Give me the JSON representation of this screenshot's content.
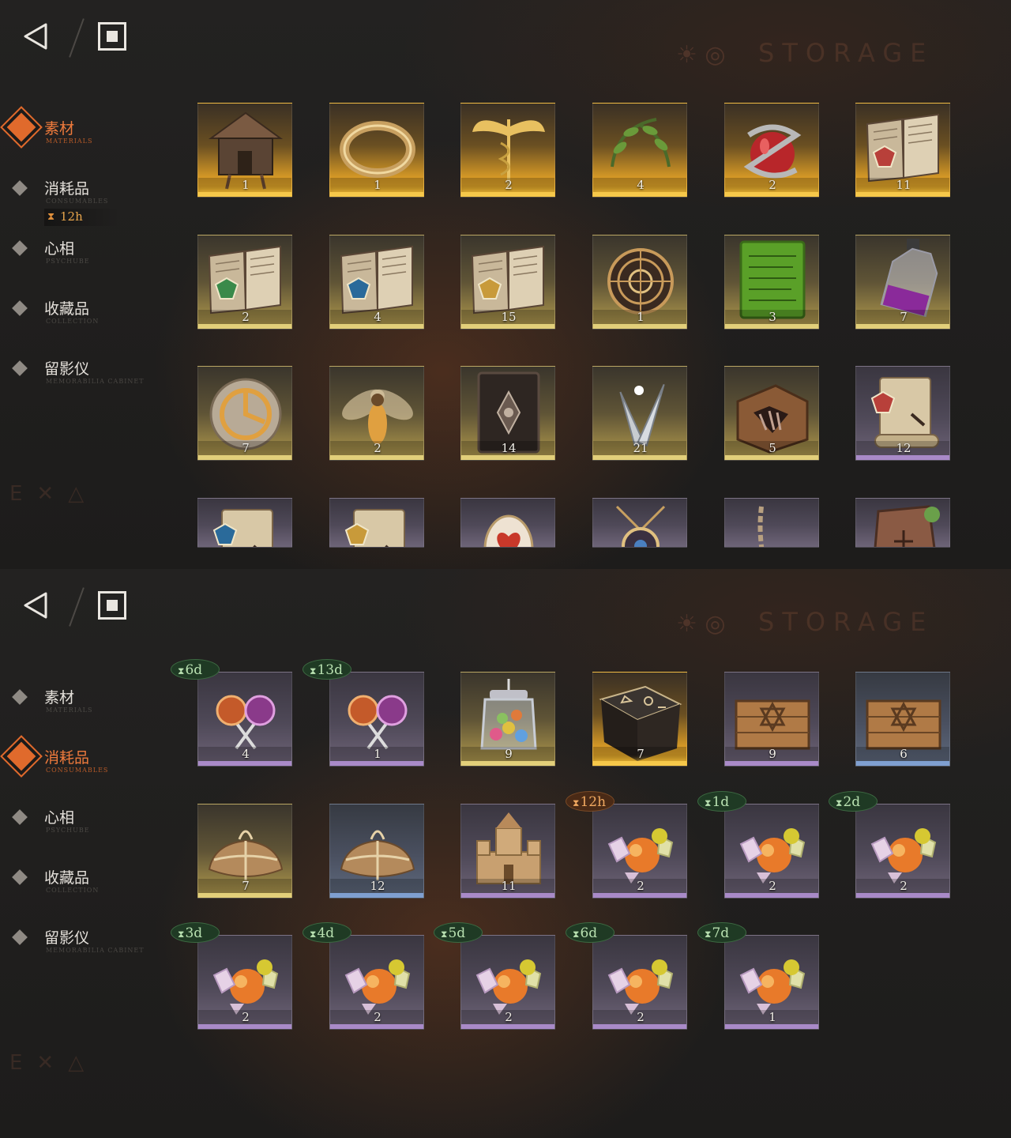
{
  "panels": [
    {
      "storage_title": "STORAGE",
      "nav": [
        {
          "label": "素材",
          "sub": "MATERIALS",
          "active": true
        },
        {
          "label": "消耗品",
          "sub": "CONSUMABLES",
          "active": false,
          "timer": "12h"
        },
        {
          "label": "心相",
          "sub": "PSYCHUBE",
          "active": false
        },
        {
          "label": "收藏品",
          "sub": "COLLECTION",
          "active": false
        },
        {
          "label": "留影仪",
          "sub": "MEMORABILIA CABINET",
          "active": false
        }
      ],
      "items": [
        {
          "icon": "hut-icon",
          "count": "1",
          "rarity": "gold"
        },
        {
          "icon": "ring-icon",
          "count": "1",
          "rarity": "gold"
        },
        {
          "icon": "caduceus-icon",
          "count": "2",
          "rarity": "gold"
        },
        {
          "icon": "laurel-wreath-icon",
          "count": "4",
          "rarity": "gold"
        },
        {
          "icon": "snake-apple-icon",
          "count": "2",
          "rarity": "gold"
        },
        {
          "icon": "red-rune-book-icon",
          "count": "11",
          "rarity": "gold"
        },
        {
          "icon": "green-rune-book-icon",
          "count": "2",
          "rarity": "yellow"
        },
        {
          "icon": "blue-rune-book-icon",
          "count": "4",
          "rarity": "yellow"
        },
        {
          "icon": "gold-rune-book-icon",
          "count": "15",
          "rarity": "yellow"
        },
        {
          "icon": "astrolabe-icon",
          "count": "1",
          "rarity": "yellow"
        },
        {
          "icon": "green-tablet-icon",
          "count": "3",
          "rarity": "yellow"
        },
        {
          "icon": "potion-bottle-icon",
          "count": "7",
          "rarity": "yellow"
        },
        {
          "icon": "clockwork-sphere-icon",
          "count": "7",
          "rarity": "yellow"
        },
        {
          "icon": "firefly-icon",
          "count": "2",
          "rarity": "yellow"
        },
        {
          "icon": "dark-tome-icon",
          "count": "14",
          "rarity": "yellow"
        },
        {
          "icon": "silver-bullets-icon",
          "count": "21",
          "rarity": "yellow"
        },
        {
          "icon": "claw-box-icon",
          "count": "5",
          "rarity": "yellow"
        },
        {
          "icon": "red-scroll-icon",
          "count": "12",
          "rarity": "purple"
        },
        {
          "icon": "blue-scroll-icon",
          "count": "",
          "rarity": "purple"
        },
        {
          "icon": "gold-scroll-icon",
          "count": "",
          "rarity": "purple"
        },
        {
          "icon": "ornate-egg-icon",
          "count": "",
          "rarity": "purple"
        },
        {
          "icon": "amulet-icon",
          "count": "",
          "rarity": "purple"
        },
        {
          "icon": "chain-icon",
          "count": "",
          "rarity": "purple"
        },
        {
          "icon": "stone-fragment-icon",
          "count": "",
          "rarity": "purple"
        }
      ]
    },
    {
      "storage_title": "STORAGE",
      "nav": [
        {
          "label": "素材",
          "sub": "MATERIALS",
          "active": false
        },
        {
          "label": "消耗品",
          "sub": "CONSUMABLES",
          "active": true
        },
        {
          "label": "心相",
          "sub": "PSYCHUBE",
          "active": false
        },
        {
          "label": "收藏品",
          "sub": "COLLECTION",
          "active": false
        },
        {
          "label": "留影仪",
          "sub": "MEMORABILIA CABINET",
          "active": false
        }
      ],
      "items": [
        {
          "icon": "lollipop-icon",
          "count": "4",
          "rarity": "purple",
          "timer": "6d",
          "timer_color": "green"
        },
        {
          "icon": "lollipop-icon",
          "count": "1",
          "rarity": "purple",
          "timer": "13d",
          "timer_color": "green"
        },
        {
          "icon": "candy-jar-icon",
          "count": "9",
          "rarity": "yellow"
        },
        {
          "icon": "rune-cube-icon",
          "count": "7",
          "rarity": "gold"
        },
        {
          "icon": "wooden-crate-icon",
          "count": "9",
          "rarity": "purple"
        },
        {
          "icon": "wooden-crate-icon",
          "count": "6",
          "rarity": "blue"
        },
        {
          "icon": "parcel-icon",
          "count": "7",
          "rarity": "yellow"
        },
        {
          "icon": "parcel-icon",
          "count": "12",
          "rarity": "blue"
        },
        {
          "icon": "sand-castle-icon",
          "count": "11",
          "rarity": "purple"
        },
        {
          "icon": "candy-icon",
          "count": "2",
          "rarity": "purple",
          "timer": "12h",
          "timer_color": "orange"
        },
        {
          "icon": "candy-icon",
          "count": "2",
          "rarity": "purple",
          "timer": "1d",
          "timer_color": "green"
        },
        {
          "icon": "candy-icon",
          "count": "2",
          "rarity": "purple",
          "timer": "2d",
          "timer_color": "green"
        },
        {
          "icon": "candy-icon",
          "count": "2",
          "rarity": "purple",
          "timer": "3d",
          "timer_color": "green"
        },
        {
          "icon": "candy-icon",
          "count": "2",
          "rarity": "purple",
          "timer": "4d",
          "timer_color": "green"
        },
        {
          "icon": "candy-icon",
          "count": "2",
          "rarity": "purple",
          "timer": "5d",
          "timer_color": "green"
        },
        {
          "icon": "candy-icon",
          "count": "2",
          "rarity": "purple",
          "timer": "6d",
          "timer_color": "green"
        },
        {
          "icon": "candy-icon",
          "count": "1",
          "rarity": "purple",
          "timer": "7d",
          "timer_color": "green"
        }
      ]
    }
  ]
}
